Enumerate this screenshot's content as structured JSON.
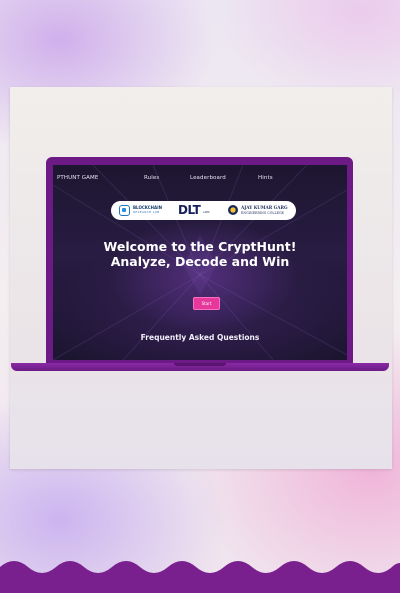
{
  "nav": {
    "items": [
      {
        "label": "PTHUNT GAME"
      },
      {
        "label": "Rules"
      },
      {
        "label": "Leaderboard"
      },
      {
        "label": "Hints"
      }
    ]
  },
  "logos": {
    "blockchain": {
      "title": "BLOCKCHAIN",
      "subtitle": "RESEARCH LAB"
    },
    "dlt": {
      "title": "DLT",
      "subtitle": "LABS"
    },
    "college": {
      "name": "AJAY KUMAR GARG",
      "subtitle": "ENGINEERING COLLEGE"
    }
  },
  "hero": {
    "line1": "Welcome to the CryptHunt!",
    "line2": "Analyze, Decode and Win",
    "start_label": "Start"
  },
  "faq": {
    "title": "Frequently Asked Questions"
  },
  "colors": {
    "laptop": "#6d1a86",
    "accent": "#e6389a",
    "screen_bg": "#1d1630",
    "wave": "#7a1f8e"
  }
}
